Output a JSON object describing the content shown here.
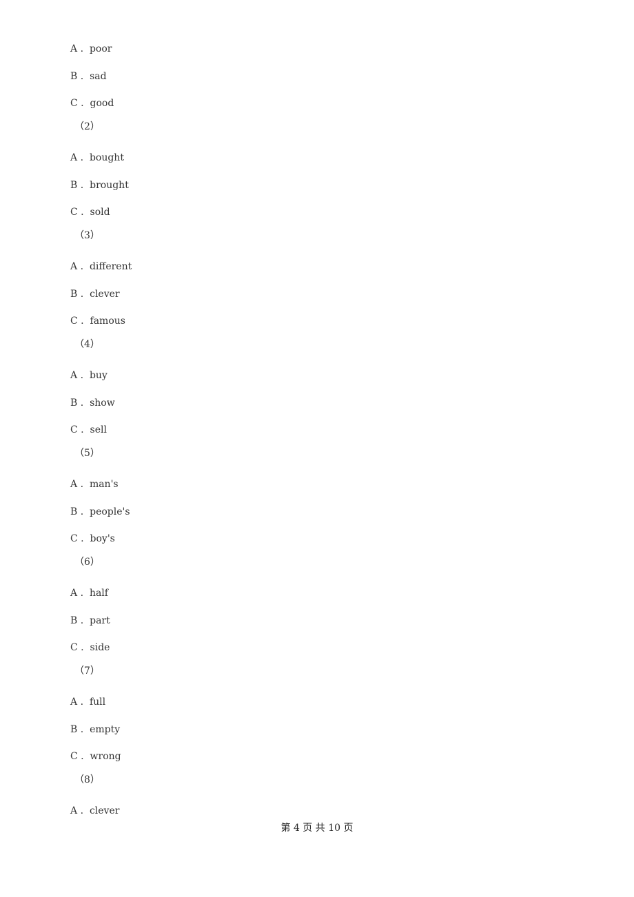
{
  "questions": [
    {
      "number": null,
      "options": [
        {
          "letter": "A",
          "text": "poor"
        },
        {
          "letter": "B",
          "text": "sad"
        },
        {
          "letter": "C",
          "text": "good"
        }
      ]
    },
    {
      "number": "（2）",
      "options": [
        {
          "letter": "A",
          "text": "bought"
        },
        {
          "letter": "B",
          "text": "brought"
        },
        {
          "letter": "C",
          "text": "sold"
        }
      ]
    },
    {
      "number": "（3）",
      "options": [
        {
          "letter": "A",
          "text": "different"
        },
        {
          "letter": "B",
          "text": "clever"
        },
        {
          "letter": "C",
          "text": "famous"
        }
      ]
    },
    {
      "number": "（4）",
      "options": [
        {
          "letter": "A",
          "text": "buy"
        },
        {
          "letter": "B",
          "text": "show"
        },
        {
          "letter": "C",
          "text": "sell"
        }
      ]
    },
    {
      "number": "（5）",
      "options": [
        {
          "letter": "A",
          "text": "man's"
        },
        {
          "letter": "B",
          "text": "people's"
        },
        {
          "letter": "C",
          "text": "boy's"
        }
      ]
    },
    {
      "number": "（6）",
      "options": [
        {
          "letter": "A",
          "text": "half"
        },
        {
          "letter": "B",
          "text": "part"
        },
        {
          "letter": "C",
          "text": "side"
        }
      ]
    },
    {
      "number": "（7）",
      "options": [
        {
          "letter": "A",
          "text": "full"
        },
        {
          "letter": "B",
          "text": "empty"
        },
        {
          "letter": "C",
          "text": "wrong"
        }
      ]
    },
    {
      "number": "（8）",
      "options": [
        {
          "letter": "A",
          "text": "clever"
        }
      ]
    }
  ],
  "footer": "第 4 页 共 10 页"
}
